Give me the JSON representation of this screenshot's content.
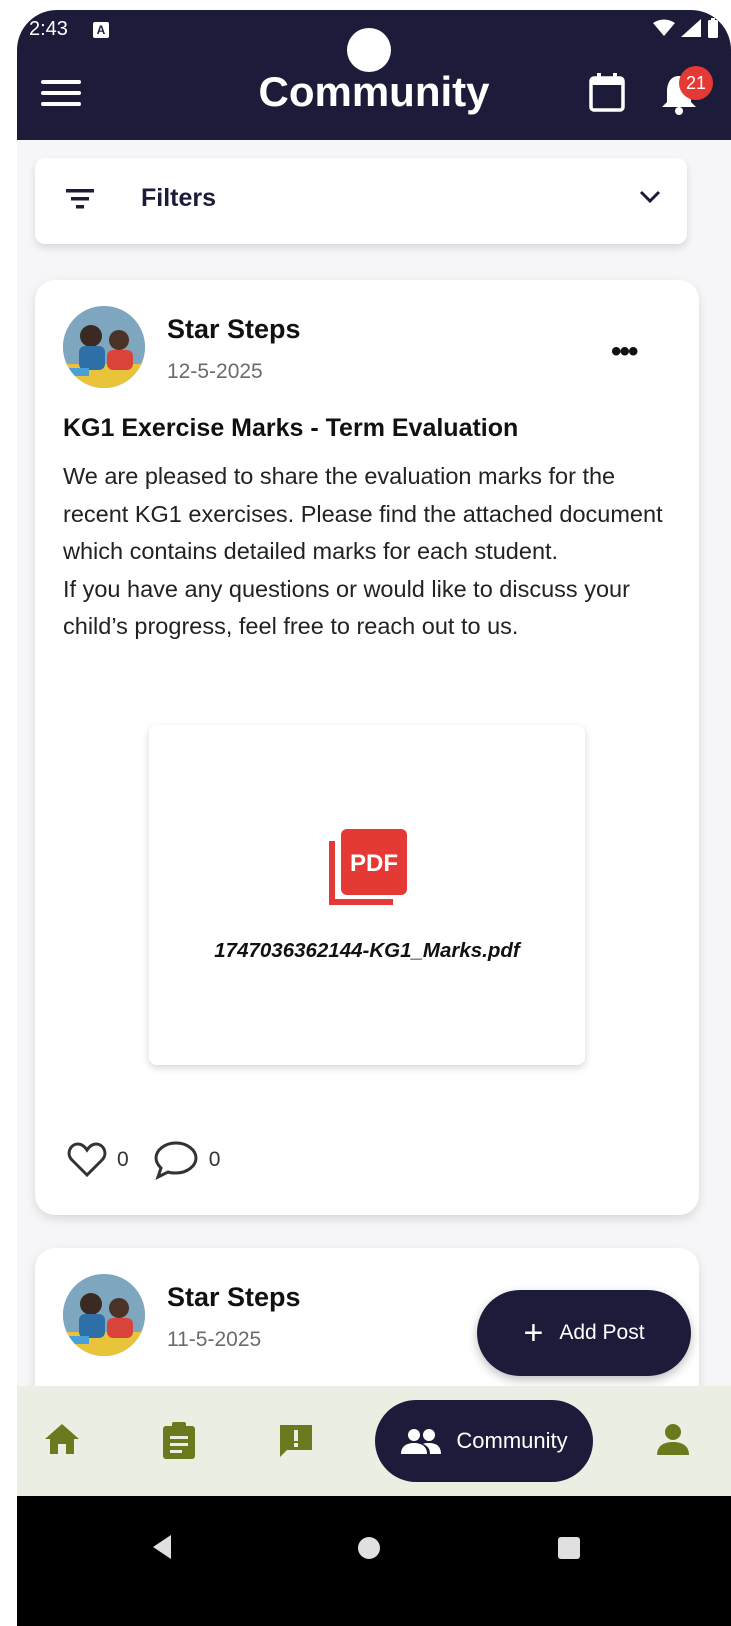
{
  "status": {
    "time": "2:43",
    "a_icon": "A"
  },
  "header": {
    "title": "Community",
    "notification_count": "21",
    "background": "#1c1c3a"
  },
  "filters": {
    "label": "Filters"
  },
  "posts": [
    {
      "author": "Star Steps",
      "date": "12-5-2025",
      "title": "KG1 Exercise Marks - Term Evaluation",
      "body": [
        "We are pleased to share the evaluation marks for the recent KG1 exercises. Please find the attached document which contains detailed marks for each student.",
        "If you have any questions or would like to discuss your child’s progress, feel free to reach out to us."
      ],
      "attachment": {
        "type_label": "PDF",
        "filename": "1747036362144-KG1_Marks.pdf"
      },
      "likes": "0",
      "comments": "0"
    },
    {
      "author": "Star Steps",
      "date": "11-5-2025"
    }
  ],
  "fab": {
    "label": "Add Post"
  },
  "bottom_nav": {
    "active_label": "Community",
    "icon_color": "#6b7a1e"
  }
}
